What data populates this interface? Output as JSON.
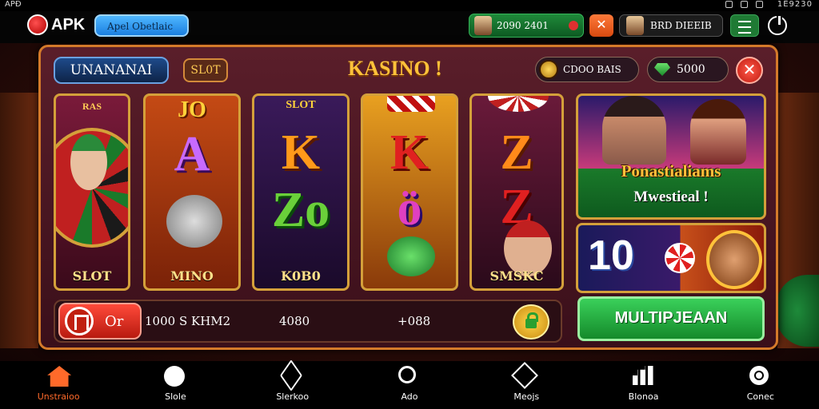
{
  "status_bar": {
    "left": "APÐ",
    "right": "1Ê9230"
  },
  "top_bar": {
    "brand": "APK",
    "search_text": "Apel Obetlaic",
    "balance_text": "2090 2401",
    "close_icon": "close-icon",
    "user_text": "BRD DIEEIB"
  },
  "panel": {
    "badge": "UNANANAI",
    "slot_chip": "SL0T",
    "title": "KASINO !",
    "coin_pill": "CDOO BAIS",
    "gem_pill": "5000"
  },
  "reels": [
    {
      "top": "RAS",
      "label": "SLOT"
    },
    {
      "top": "JO",
      "letter1": "A",
      "label": "MINO"
    },
    {
      "top": "SLOT",
      "letter1": "K",
      "letter2": "Zo",
      "label": "K0B0"
    },
    {
      "letter1": "K",
      "letter2": "ö",
      "label": ""
    },
    {
      "letter1": "Z",
      "letter2": "Z",
      "label": "SMSKC"
    }
  ],
  "promo": {
    "title": "Ponastialiams",
    "subtitle": "Mwestieal !"
  },
  "bonus": {
    "number": "10"
  },
  "controls": {
    "spin_label": "Or",
    "text1": "1000 S KHM2",
    "text2": "4080",
    "text3": "+088"
  },
  "multi_button": "MULTIPJEAAN",
  "nav": [
    {
      "label": "Unstraioo",
      "icon": "home-icon"
    },
    {
      "label": "Slole",
      "icon": "circle-icon"
    },
    {
      "label": "Slerkoo",
      "icon": "arrow-icon"
    },
    {
      "label": "Ado",
      "icon": "search-icon"
    },
    {
      "label": "Meojs",
      "icon": "cube-icon"
    },
    {
      "label": "Blonoa",
      "icon": "chart-icon"
    },
    {
      "label": "Conec",
      "icon": "gear-icon"
    }
  ],
  "colors": {
    "accent": "#ffc23a",
    "panel_border": "#d47a2a",
    "nav_active": "#ff6a2a"
  }
}
